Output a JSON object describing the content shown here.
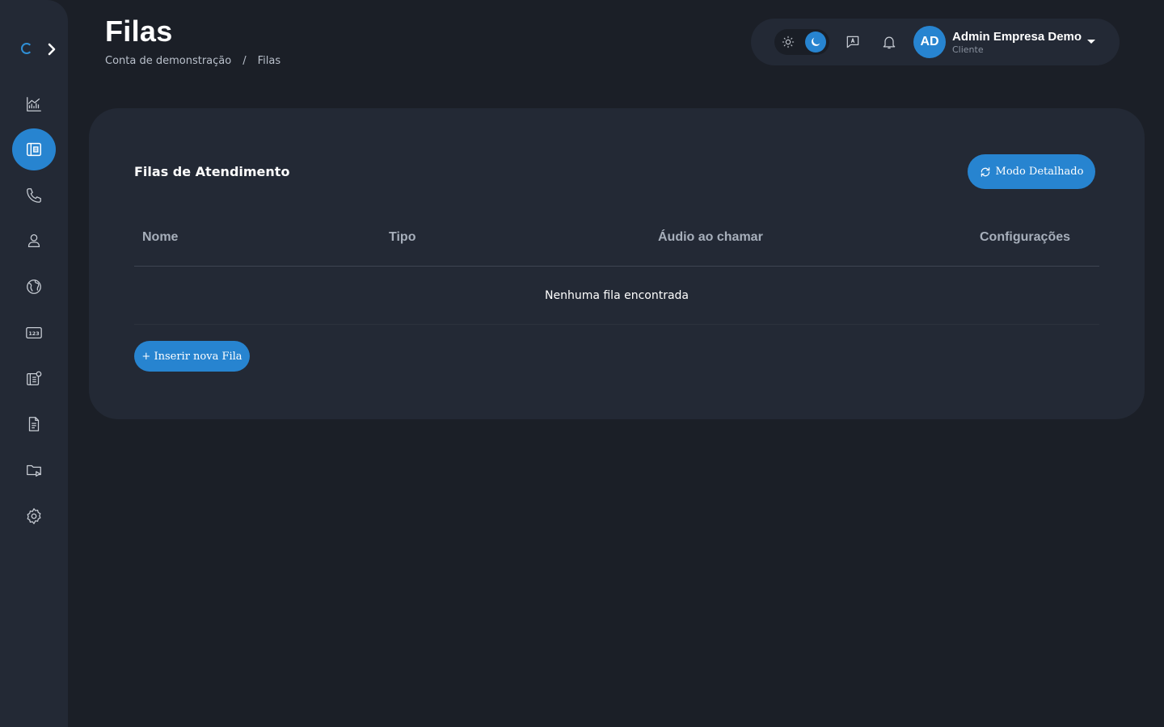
{
  "page": {
    "title": "Filas",
    "breadcrumb": [
      "Conta de demonstração",
      "/",
      "Filas"
    ]
  },
  "sidebar": {
    "items": [
      {
        "name": "dashboard",
        "icon": "chart-line-icon",
        "active": false
      },
      {
        "name": "queues",
        "icon": "queue-list-icon",
        "active": true
      },
      {
        "name": "calls",
        "icon": "phone-icon",
        "active": false
      },
      {
        "name": "users",
        "icon": "user-icon",
        "active": false
      },
      {
        "name": "routes",
        "icon": "globe-icon",
        "active": false
      },
      {
        "name": "numbers",
        "icon": "numbers-123-icon",
        "active": false
      },
      {
        "name": "ivr",
        "icon": "ivr-icon",
        "active": false
      },
      {
        "name": "reports",
        "icon": "document-icon",
        "active": false
      },
      {
        "name": "recordings",
        "icon": "folder-play-icon",
        "active": false
      },
      {
        "name": "settings",
        "icon": "gear-icon",
        "active": false
      }
    ]
  },
  "topbar": {
    "theme": "dark",
    "user_initials": "AD",
    "user_name": "Admin Empresa Demo",
    "user_role": "Cliente"
  },
  "card": {
    "title": "Filas de Atendimento",
    "mode_button_label": "Modo Detalhado",
    "columns": [
      "Nome",
      "Tipo",
      "Áudio ao chamar",
      "Configurações"
    ],
    "empty_message": "Nenhuma fila encontrada",
    "insert_button_label": "+ Inserir nova Fila"
  },
  "colors": {
    "background": "#1b1f27",
    "surface": "#232935",
    "accent": "#2784d0"
  }
}
